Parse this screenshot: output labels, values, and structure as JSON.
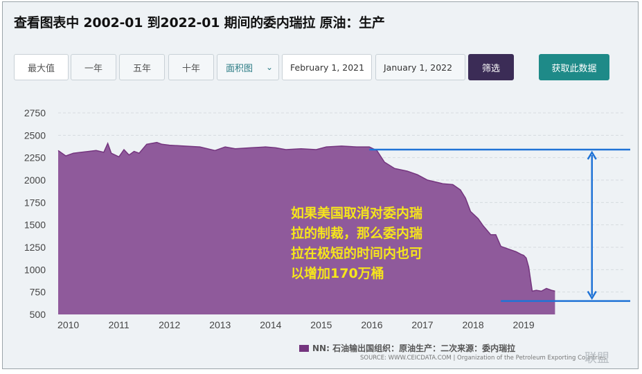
{
  "title": "查看图表中 2002-01 到2022-01 期间的委内瑞拉 原油：生产",
  "toolbar": {
    "range_buttons": [
      "最大值",
      "一年",
      "五年",
      "十年"
    ],
    "chart_type_select": "面积图",
    "start_date": "February 1, 2021",
    "end_date": "January 1, 2022",
    "filter_label": "筛选",
    "fetch_label": "获取此数据"
  },
  "annotation": {
    "lines": [
      "如果美国取消对委内瑞",
      "拉的制裁，那么委内瑞",
      "拉在极短的时间内也可",
      "以增加170万桶"
    ],
    "color": "#f5e51c"
  },
  "legend": {
    "label": "NN: 石油输出国组织：原油生产：二次来源：委内瑞拉",
    "color": "#74357e"
  },
  "source": "SOURCE: WWW.CEICDATA.COM | Organization of the Petroleum Exporting Countries",
  "watermark": "联盟",
  "colors": {
    "area_fill": "#8f5a9b",
    "area_line": "#74357e",
    "arrow": "#1f73d6",
    "background": "#eef2f5"
  },
  "chart_data": {
    "type": "area",
    "title": "",
    "xlabel": "",
    "ylabel": "",
    "ylim": [
      500,
      2750
    ],
    "xlim": [
      2009.8,
      2020.6
    ],
    "yticks": [
      500,
      750,
      1000,
      1250,
      1500,
      1750,
      2000,
      2250,
      2500,
      2750
    ],
    "xticks": [
      2010,
      2011,
      2012,
      2013,
      2014,
      2015,
      2016,
      2017,
      2018,
      2019
    ],
    "grid": true,
    "series": [
      {
        "name": "NN: 石油输出国组织：原油生产：二次来源：委内瑞拉",
        "points": [
          [
            2009.8,
            2330
          ],
          [
            2009.95,
            2270
          ],
          [
            2010.1,
            2300
          ],
          [
            2010.25,
            2310
          ],
          [
            2010.4,
            2320
          ],
          [
            2010.55,
            2330
          ],
          [
            2010.7,
            2310
          ],
          [
            2010.78,
            2410
          ],
          [
            2010.85,
            2300
          ],
          [
            2011.0,
            2260
          ],
          [
            2011.1,
            2340
          ],
          [
            2011.2,
            2280
          ],
          [
            2011.3,
            2320
          ],
          [
            2011.4,
            2300
          ],
          [
            2011.55,
            2400
          ],
          [
            2011.75,
            2420
          ],
          [
            2011.85,
            2400
          ],
          [
            2012.0,
            2390
          ],
          [
            2012.3,
            2380
          ],
          [
            2012.6,
            2370
          ],
          [
            2012.9,
            2330
          ],
          [
            2013.1,
            2370
          ],
          [
            2013.3,
            2350
          ],
          [
            2013.6,
            2360
          ],
          [
            2013.9,
            2370
          ],
          [
            2014.1,
            2360
          ],
          [
            2014.3,
            2340
          ],
          [
            2014.6,
            2350
          ],
          [
            2014.9,
            2340
          ],
          [
            2015.1,
            2370
          ],
          [
            2015.4,
            2380
          ],
          [
            2015.7,
            2370
          ],
          [
            2015.95,
            2370
          ],
          [
            2016.1,
            2330
          ],
          [
            2016.25,
            2200
          ],
          [
            2016.45,
            2130
          ],
          [
            2016.7,
            2100
          ],
          [
            2016.9,
            2060
          ],
          [
            2017.1,
            2000
          ],
          [
            2017.4,
            1960
          ],
          [
            2017.6,
            1950
          ],
          [
            2017.75,
            1890
          ],
          [
            2017.85,
            1800
          ],
          [
            2017.95,
            1650
          ],
          [
            2018.1,
            1570
          ],
          [
            2018.2,
            1490
          ],
          [
            2018.35,
            1390
          ],
          [
            2018.45,
            1390
          ],
          [
            2018.55,
            1260
          ],
          [
            2018.7,
            1230
          ],
          [
            2018.85,
            1200
          ],
          [
            2018.95,
            1170
          ],
          [
            2019.0,
            1160
          ],
          [
            2019.05,
            1130
          ],
          [
            2019.1,
            1030
          ],
          [
            2019.17,
            760
          ],
          [
            2019.25,
            770
          ],
          [
            2019.35,
            760
          ],
          [
            2019.45,
            790
          ],
          [
            2019.55,
            770
          ],
          [
            2019.62,
            760
          ]
        ]
      }
    ],
    "reference_lines_y": [
      2340,
      650
    ],
    "double_arrow": {
      "x": 2020.35,
      "from": 2340,
      "to": 650
    }
  }
}
